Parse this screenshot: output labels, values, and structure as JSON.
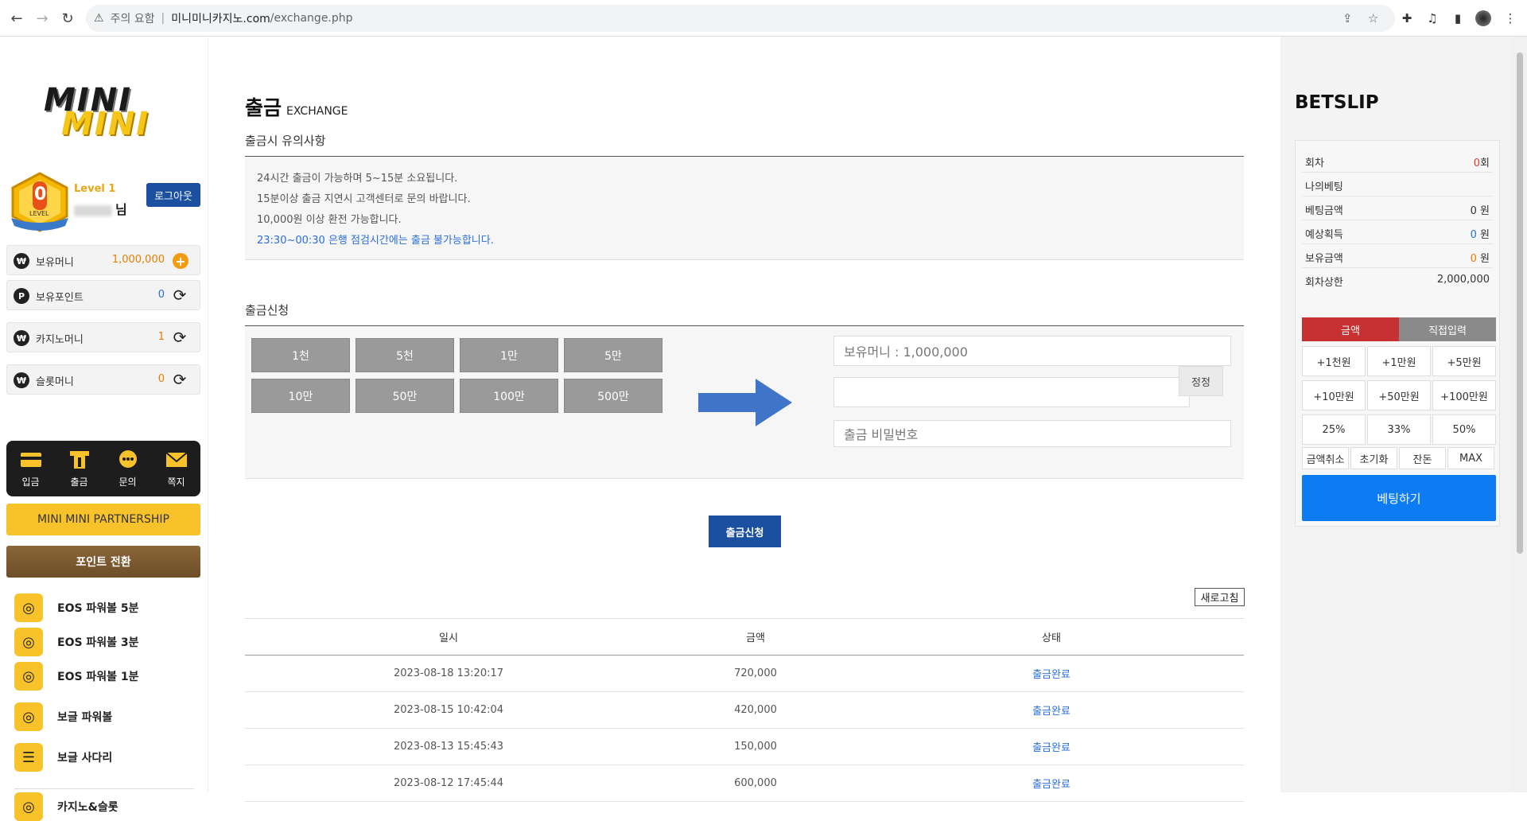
{
  "browser": {
    "security_label": "주의 요함",
    "separator": "|",
    "url_host": "미니미니카지노.com",
    "url_path": "/exchange.php"
  },
  "sidebar": {
    "logo": {
      "line1": "MINI",
      "line2": "MINI"
    },
    "level_badge_number": "0",
    "level_badge_text": "LEVEL",
    "level_label": "Level 1",
    "user_suffix": "님",
    "logout_label": "로그아웃",
    "money_rows": [
      {
        "icon": "₩",
        "label": "보유머니",
        "value": "1,000,000",
        "action": "+"
      },
      {
        "icon": "P",
        "label": "보유포인트",
        "value": "0",
        "action": "⟳"
      },
      {
        "icon": "₩",
        "label": "카지노머니",
        "value": "1",
        "action": "⟳"
      },
      {
        "icon": "₩",
        "label": "슬롯머니",
        "value": "0",
        "action": "⟳"
      }
    ],
    "quick_menu": [
      {
        "label": "입금",
        "icon": "card-icon"
      },
      {
        "label": "출금",
        "icon": "withdraw-icon"
      },
      {
        "label": "문의",
        "icon": "chat-icon"
      },
      {
        "label": "쪽지",
        "icon": "mail-icon"
      }
    ],
    "partnership_label": "MINI MINI PARTNERSHIP",
    "point_convert_label": "포인트 전환",
    "games": [
      {
        "label": "EOS 파워볼 5분",
        "icon": "powerball-icon"
      },
      {
        "label": "EOS 파워볼 3분",
        "icon": "powerball-icon"
      },
      {
        "label": "EOS 파워볼 1분",
        "icon": "powerball-icon"
      },
      {
        "label": "보글 파워볼",
        "icon": "powerball-icon"
      },
      {
        "label": "보글 사다리",
        "icon": "ladder-icon"
      },
      {
        "label": "카지노&슬롯",
        "icon": "casino-icon"
      }
    ]
  },
  "main": {
    "title": "출금",
    "title_sub": "EXCHANGE",
    "notice_title": "출금시 유의사항",
    "notices": [
      "24시간 출금이 가능하며 5~15분 소요됩니다.",
      "15분이상 출금 지연시 고객센터로 문의 바랍니다.",
      "10,000원 이상 환전 가능합니다.",
      "23:30~00:30 은행 점검시간에는 출금 불가능합니다."
    ],
    "request_title": "출금신청",
    "amount_buttons": [
      "1천",
      "5천",
      "1만",
      "5만",
      "10만",
      "50만",
      "100만",
      "500만"
    ],
    "balance_field": "보유머니 : 1,000,000",
    "amount_input_value": "",
    "edit_label": "정정",
    "password_placeholder": "출금 비밀번호",
    "submit_label": "출금신청",
    "refresh_label": "새로고침",
    "table": {
      "headers": [
        "일시",
        "금액",
        "상태"
      ],
      "rows": [
        [
          "2023-08-18 13:20:17",
          "720,000",
          "출금완료"
        ],
        [
          "2023-08-15 10:42:04",
          "420,000",
          "출금완료"
        ],
        [
          "2023-08-13 15:45:43",
          "150,000",
          "출금완료"
        ],
        [
          "2023-08-12 17:45:44",
          "600,000",
          "출금완료"
        ]
      ]
    }
  },
  "betslip": {
    "title": "BETSLIP",
    "rows": [
      {
        "label": "회차",
        "value": "0",
        "unit": "회",
        "color": "red"
      },
      {
        "label": "나의베팅",
        "value": "",
        "unit": "",
        "color": ""
      },
      {
        "label": "베팅금액",
        "value": "0",
        "unit": " 원",
        "color": ""
      },
      {
        "label": "예상획득",
        "value": "0",
        "unit": " 원",
        "color": "blue"
      },
      {
        "label": "보유금액",
        "value": "0",
        "unit": " 원",
        "color": "orange"
      },
      {
        "label": "회차상한",
        "value": "2,000,000",
        "unit": "",
        "color": ""
      }
    ],
    "tab_amount": "금액",
    "tab_direct": "직접입력",
    "amount_buttons": [
      "+1천원",
      "+1만원",
      "+5만원",
      "+10만원",
      "+50만원",
      "+100만원",
      "25%",
      "33%",
      "50%"
    ],
    "action_buttons": [
      "금액취소",
      "초기화",
      "잔돈",
      "MAX"
    ],
    "bet_label": "베팅하기"
  }
}
